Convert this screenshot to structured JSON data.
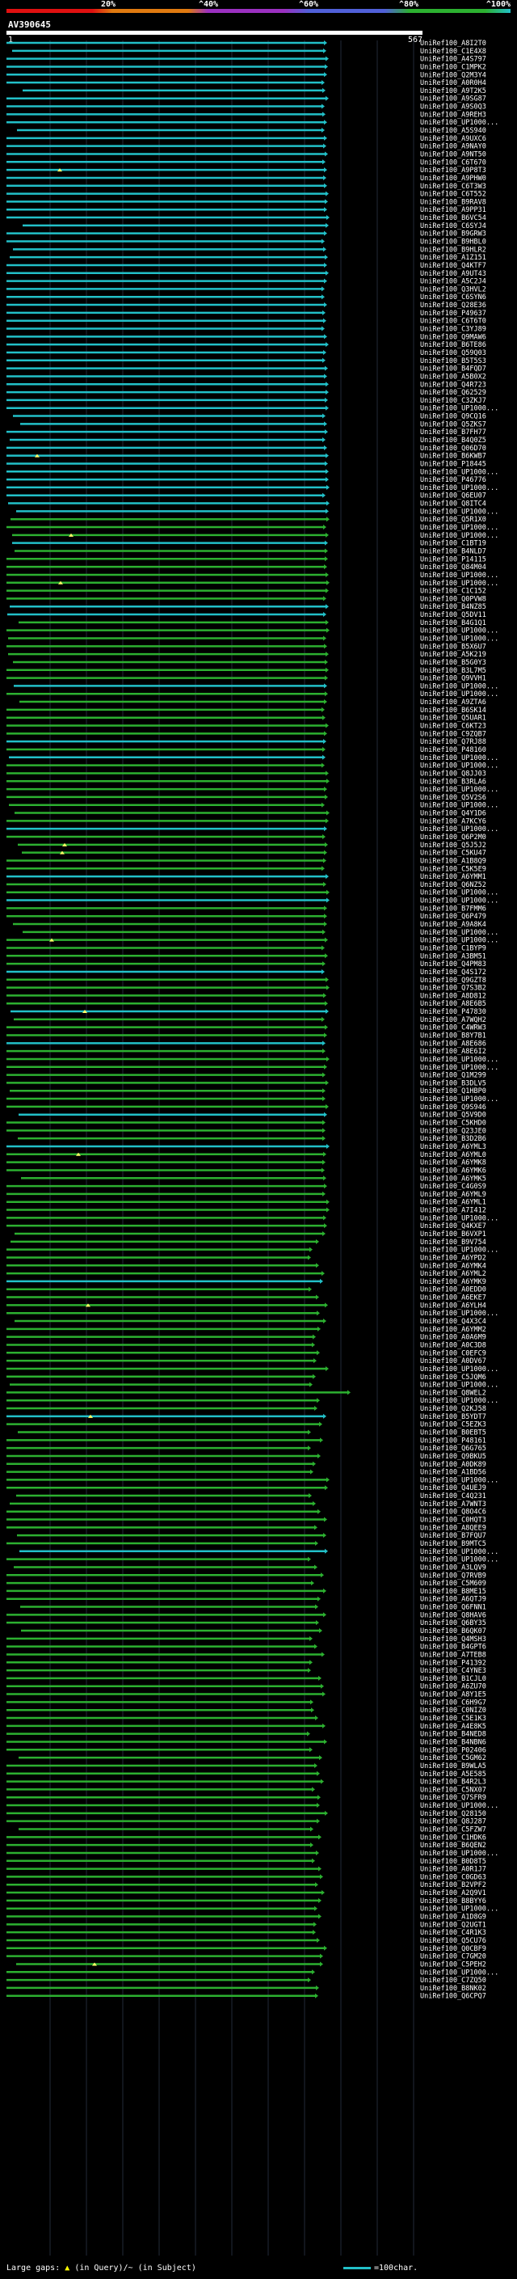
{
  "scale": {
    "labels": [
      "20%",
      "^40%",
      "^60%",
      "^80%",
      "^100%"
    ],
    "colors": [
      "#e01010",
      "#e07a10",
      "#9b30c0",
      "#5060d8",
      "#2cb030",
      "#22c0c8"
    ]
  },
  "query": {
    "name": "AV390645",
    "start": "1",
    "end": "567"
  },
  "hits": [
    "UniRef100_A8I2T0",
    "UniRef100_C1E4X8",
    "UniRef100_A4S797",
    "UniRef100_C1MPK2",
    "UniRef100_Q2M3Y4",
    "UniRef100_A0R0H4",
    "UniRef100_A9T2K5",
    "UniRef100_A9SG87",
    "UniRef100_A9S0Q3",
    "UniRef100_A9REH3",
    "UniRef100_UP1000...",
    "UniRef100_A5S940",
    "UniRef100_A9UXC6",
    "UniRef100_A9NAY0",
    "UniRef100_A9NT50",
    "UniRef100_C6T670",
    "UniRef100_A9P8T3",
    "UniRef100_A9PHW0",
    "UniRef100_C6T3W3",
    "UniRef100_C6T552",
    "UniRef100_B9RAV8",
    "UniRef100_A9PP31",
    "UniRef100_B6VC54",
    "UniRef100_C6SYJ4",
    "UniRef100_B9GRW3",
    "UniRef100_B9HBL0",
    "UniRef100_B9HLR2",
    "UniRef100_A1Z151",
    "UniRef100_Q4KTF7",
    "UniRef100_A9UT43",
    "UniRef100_A5C2J4",
    "UniRef100_Q3HVL2",
    "UniRef100_C6SYN6",
    "UniRef100_Q28E36",
    "UniRef100_P49637",
    "UniRef100_C6T6T0",
    "UniRef100_C3YJ89",
    "UniRef100_Q9MAW6",
    "UniRef100_B6TE86",
    "UniRef100_Q59Q03",
    "UniRef100_B5T5S3",
    "UniRef100_B4FQD7",
    "UniRef100_A5B0X2",
    "UniRef100_Q4R723",
    "UniRef100_Q62529",
    "UniRef100_C3ZKJ7",
    "UniRef100_UP1000...",
    "UniRef100_Q9CQ16",
    "UniRef100_Q5ZKS7",
    "UniRef100_B7FH77",
    "UniRef100_B4Q0Z5",
    "UniRef100_Q06D70",
    "UniRef100_B6KWB7",
    "UniRef100_P18445",
    "UniRef100_UP1000...",
    "UniRef100_P46776",
    "UniRef100_UP1000...",
    "UniRef100_Q6EU07",
    "UniRef100_Q8ITC4",
    "UniRef100_UP1000...",
    "UniRef100_Q5R1X0",
    "UniRef100_UP1000...",
    "UniRef100_UP1000...",
    "UniRef100_C1BT19",
    "UniRef100_B4NLD7",
    "UniRef100_P14115",
    "UniRef100_Q84M04",
    "UniRef100_UP1000...",
    "UniRef100_UP1000...",
    "UniRef100_C1C152",
    "UniRef100_Q0PVW8",
    "UniRef100_B4NZ85",
    "UniRef100_Q5DV11",
    "UniRef100_B4G1Q1",
    "UniRef100_UP1000...",
    "UniRef100_UP1000...",
    "UniRef100_B5X6U7",
    "UniRef100_A5K219",
    "UniRef100_B5G0Y3",
    "UniRef100_B3L7M5",
    "UniRef100_Q9VVH1",
    "UniRef100_UP1000...",
    "UniRef100_UP1000...",
    "UniRef100_A9ZTA6",
    "UniRef100_B6SK14",
    "UniRef100_Q5UAR1",
    "UniRef100_C6KT23",
    "UniRef100_C9ZQB7",
    "UniRef100_Q7RJ88",
    "UniRef100_P48160",
    "UniRef100_UP1000...",
    "UniRef100_UP1000...",
    "UniRef100_Q8JJ03",
    "UniRef100_B3RLA6",
    "UniRef100_UP1000...",
    "UniRef100_Q5V2S6",
    "UniRef100_UP1000...",
    "UniRef100_Q4Y1D6",
    "UniRef100_A7KCY6",
    "UniRef100_UP1000...",
    "UniRef100_Q6P2M0",
    "UniRef100_Q5J5J2",
    "UniRef100_C5KU47",
    "UniRef100_A1B8Q9",
    "UniRef100_C5K5E9",
    "UniRef100_A6YMM1",
    "UniRef100_Q6NZ52",
    "UniRef100_UP1000...",
    "UniRef100_UP1000...",
    "UniRef100_B7FMM6",
    "UniRef100_Q6P479",
    "UniRef100_A9A8K4",
    "UniRef100_UP1000...",
    "UniRef100_UP1000...",
    "UniRef100_C1BYP9",
    "UniRef100_A3BM51",
    "UniRef100_Q4PM83",
    "UniRef100_Q4S172",
    "UniRef100_Q9GZT8",
    "UniRef100_Q7S3B2",
    "UniRef100_A8D812",
    "UniRef100_A8E6B5",
    "UniRef100_P47830",
    "UniRef100_A7WQH2",
    "UniRef100_C4WRW3",
    "UniRef100_B8Y7B1",
    "UniRef100_A8E686",
    "UniRef100_A8E6I2",
    "UniRef100_UP1000...",
    "UniRef100_UP1000...",
    "UniRef100_Q1M299",
    "UniRef100_B3DLV5",
    "UniRef100_Q1HBP0",
    "UniRef100_UP1000...",
    "UniRef100_Q9S946",
    "UniRef100_Q5V9D0",
    "UniRef100_C5KHD0",
    "UniRef100_Q23JE0",
    "UniRef100_B3D2B6",
    "UniRef100_A6YML3",
    "UniRef100_A6YML0",
    "UniRef100_A6YMK8",
    "UniRef100_A6YMK6",
    "UniRef100_A6YMK5",
    "UniRef100_C4G0S9",
    "UniRef100_A6YML9",
    "UniRef100_A6YML1",
    "UniRef100_A7I412",
    "UniRef100_UP1000...",
    "UniRef100_Q4KXE7",
    "UniRef100_B6VXP1",
    "UniRef100_B9V754",
    "UniRef100_UP1000...",
    "UniRef100_A6YPD2",
    "UniRef100_A6YMK4",
    "UniRef100_A6YML2",
    "UniRef100_A6YMK9",
    "UniRef100_A0EDD0",
    "UniRef100_A6EKE7",
    "UniRef100_A6YLH4",
    "UniRef100_UP1000...",
    "UniRef100_Q4X3C4",
    "UniRef100_A6YMM2",
    "UniRef100_A0A6M9",
    "UniRef100_A0C3D8",
    "UniRef100_C0EFC9",
    "UniRef100_A0DV67",
    "UniRef100_UP1000...",
    "UniRef100_C5JQM6",
    "UniRef100_UP1000...",
    "UniRef100_Q8WEL2",
    "UniRef100_UP1000...",
    "UniRef100_Q2KJ58",
    "UniRef100_B5YDT7",
    "UniRef100_C5EZK3",
    "UniRef100_B0EBT5",
    "UniRef100_P48161",
    "UniRef100_Q6G765",
    "UniRef100_Q9BKU5",
    "UniRef100_A0DK89",
    "UniRef100_A1BD56",
    "UniRef100_UP1000...",
    "UniRef100_Q4UEJ9",
    "UniRef100_C4Q231",
    "UniRef100_A7WNT3",
    "UniRef100_Q8O4C6",
    "UniRef100_C0HQT3",
    "UniRef100_A8QEE9",
    "UniRef100_B7FQU7",
    "UniRef100_B9MTC5",
    "UniRef100_UP1000...",
    "UniRef100_UP1000...",
    "UniRef100_A3LQV9",
    "UniRef100_Q7RVB9",
    "UniRef100_C5M609",
    "UniRef100_B8ME15",
    "UniRef100_A6QTJ9",
    "UniRef100_Q6FNN1",
    "UniRef100_Q8HAV6",
    "UniRef100_Q6BY35",
    "UniRef100_B6QK07",
    "UniRef100_Q4MSH3",
    "UniRef100_B4GPT6",
    "UniRef100_A7TEB8",
    "UniRef100_P41392",
    "UniRef100_C4YNE3",
    "UniRef100_B1CJL0",
    "UniRef100_A6ZU70",
    "UniRef100_A8Y1E5",
    "UniRef100_C6H9G7",
    "UniRef100_C0NIZ0",
    "UniRef100_C5E1K3",
    "UniRef100_A4E8K5",
    "UniRef100_B4NED8",
    "UniRef100_B4NBN6",
    "UniRef100_P02406",
    "UniRef100_C5GM62",
    "UniRef100_B9WLA5",
    "UniRef100_A5E585",
    "UniRef100_B4R2L3",
    "UniRef100_C5NX07",
    "UniRef100_Q7SFR9",
    "UniRef100_UP1000...",
    "UniRef100_Q28150",
    "UniRef100_Q8J287",
    "UniRef100_C5FZW7",
    "UniRef100_C1HDK6",
    "UniRef100_B6QEN2",
    "UniRef100_UP1000...",
    "UniRef100_B0D8T5",
    "UniRef100_A0R1J7",
    "UniRef100_C0GD63",
    "UniRef100_B2VPF2",
    "UniRef100_A2Q9V1",
    "UniRef100_B8BYY6",
    "UniRef100_UP1000...",
    "UniRef100_A1D8G9",
    "UniRef100_Q2UGT1",
    "UniRef100_C4R1K3",
    "UniRef100_Q5CU76",
    "UniRef100_Q0CBF9",
    "UniRef100_C7GM20",
    "UniRef100_C5PEH2",
    "UniRef100_UP1000...",
    "UniRef100_C7ZQ50",
    "UniRef100_B8NK02",
    "UniRef100_Q6CPQ7"
  ],
  "footer": {
    "label": "Large gaps:",
    "mid": "(in Query)/~ (in Subject)",
    "legend": "=100char."
  }
}
